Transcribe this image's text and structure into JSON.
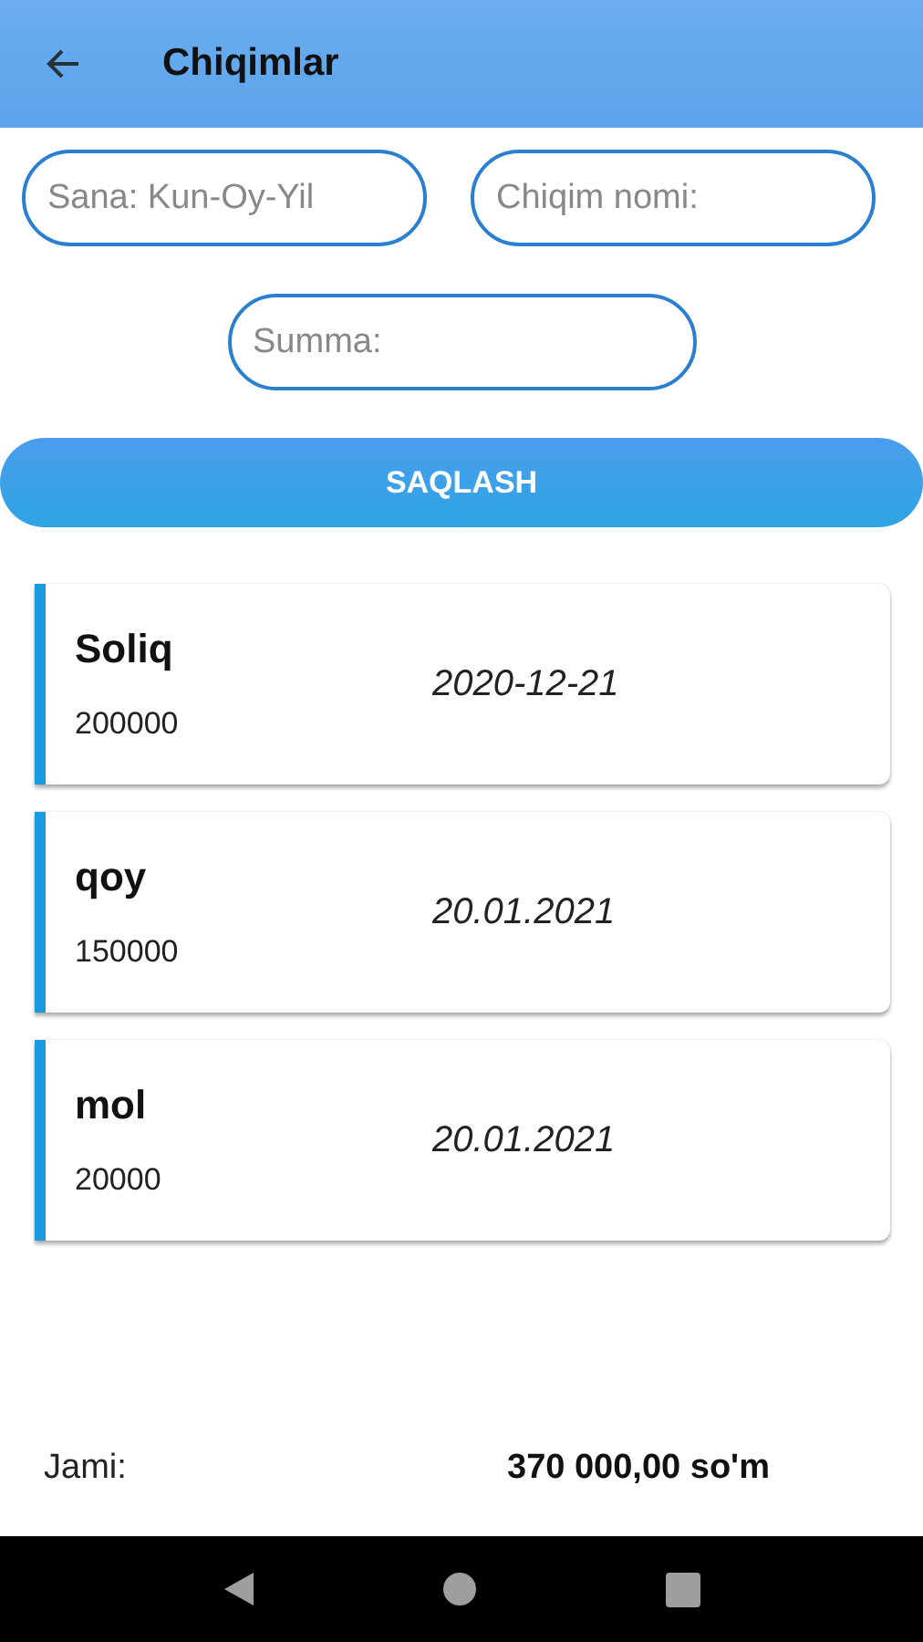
{
  "app_bar": {
    "title": "Chiqimlar"
  },
  "form": {
    "date_placeholder": "Sana: Kun-Oy-Yil",
    "name_placeholder": "Chiqim nomi:",
    "amount_placeholder": "Summa:",
    "save_button": "SAQLASH"
  },
  "expenses": [
    {
      "name": "Soliq",
      "amount": "200000",
      "date": "2020-12-21"
    },
    {
      "name": "qoy",
      "amount": "150000",
      "date": "20.01.2021"
    },
    {
      "name": "mol",
      "amount": "20000",
      "date": "20.01.2021"
    }
  ],
  "total": {
    "label": "Jami:",
    "value": "370 000,00 so'm"
  }
}
